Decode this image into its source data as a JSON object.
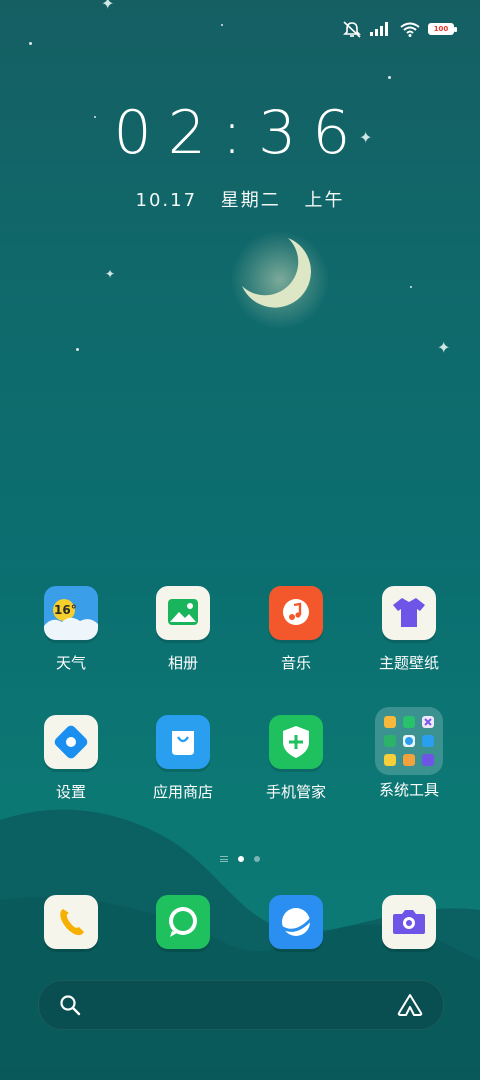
{
  "status_bar": {
    "battery_text": "100"
  },
  "lockscreen": {
    "time": "02:36",
    "date": {
      "day": "10.17",
      "weekday": "星期二",
      "period": "上午"
    }
  },
  "apps": [
    {
      "label": "天气",
      "icon": "weather-icon",
      "badge": "16°"
    },
    {
      "label": "相册",
      "icon": "gallery-icon"
    },
    {
      "label": "音乐",
      "icon": "music-icon"
    },
    {
      "label": "主题壁纸",
      "icon": "theme-wallpaper-icon"
    },
    {
      "label": "设置",
      "icon": "settings-icon"
    },
    {
      "label": "应用商店",
      "icon": "app-store-icon"
    },
    {
      "label": "手机管家",
      "icon": "phone-manager-icon"
    },
    {
      "label": "系统工具",
      "icon": "system-tools-folder-icon"
    }
  ],
  "dock": [
    {
      "icon": "phone-icon"
    },
    {
      "icon": "messages-icon"
    },
    {
      "icon": "browser-icon"
    },
    {
      "icon": "camera-icon"
    }
  ],
  "page_indicator": {
    "count": 2,
    "active": 1
  },
  "search_bar": {
    "left_icon": "search-icon",
    "right_icon": "assistant-icon"
  },
  "colors": {
    "bg_top": "#155f63",
    "bg_bottom": "#0d7a76",
    "accent": "#ffffff"
  }
}
